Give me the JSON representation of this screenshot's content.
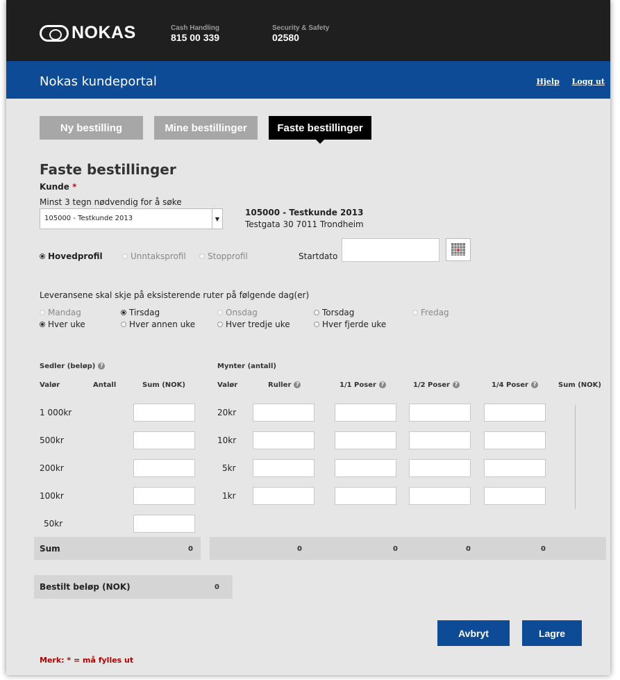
{
  "header": {
    "logo_text": "NOKAS",
    "contacts": [
      {
        "label": "Cash Handling",
        "number": "815 00 339"
      },
      {
        "label": "Security & Safety",
        "number": "02580"
      }
    ],
    "portal_title": "Nokas kundeportal",
    "links": {
      "help": "Hjelp",
      "logout": "Logg ut"
    }
  },
  "tabs": [
    {
      "label": "Ny bestilling",
      "active": false
    },
    {
      "label": "Mine bestillinger",
      "active": false
    },
    {
      "label": "Faste bestillinger",
      "active": true
    }
  ],
  "form": {
    "title": "Faste bestillinger",
    "customer_label": "Kunde",
    "required_mark": "*",
    "search_hint": "Minst 3 tegn nødvendig for å søke",
    "customer_value": "105000 - Testkunde 2013",
    "customer_name": "105000 - Testkunde 2013",
    "customer_address": "Testgata 30 7011 Trondheim",
    "profiles": [
      {
        "label": "Hovedprofil",
        "selected": true,
        "enabled": true
      },
      {
        "label": "Unntaksprofil",
        "selected": false,
        "enabled": false
      },
      {
        "label": "Stopprofil",
        "selected": false,
        "enabled": false
      }
    ],
    "start_date_label": "Startdato",
    "start_date_value": "",
    "delivery_text": "Leveransene skal skje på eksisterende ruter på følgende dag(er)",
    "days": [
      {
        "label": "Mandag",
        "selected": false,
        "enabled": false
      },
      {
        "label": "Tirsdag",
        "selected": true,
        "enabled": true
      },
      {
        "label": "Onsdag",
        "selected": false,
        "enabled": false
      },
      {
        "label": "Torsdag",
        "selected": false,
        "enabled": true
      },
      {
        "label": "Fredag",
        "selected": false,
        "enabled": false
      }
    ],
    "frequencies": [
      {
        "label": "Hver uke",
        "selected": true
      },
      {
        "label": "Hver annen uke",
        "selected": false
      },
      {
        "label": "Hver tredje uke",
        "selected": false
      },
      {
        "label": "Hver fjerde uke",
        "selected": false
      }
    ]
  },
  "notes_section": {
    "title": "Sedler (beløp)",
    "col_valor": "Valør",
    "col_antall": "Antall",
    "col_sum": "Sum (NOK)",
    "rows": [
      "1 000kr",
      "500kr",
      "200kr",
      "100kr",
      "50kr"
    ]
  },
  "coins_section": {
    "title": "Mynter (antall)",
    "col_valor": "Valør",
    "col_ruller": "Ruller",
    "col_full": "1/1 Poser",
    "col_half": "1/2 Poser",
    "col_quarter": "1/4 Poser",
    "col_sum": "Sum (NOK)",
    "rows": [
      "20kr",
      "10kr",
      "5kr",
      "1kr"
    ]
  },
  "sums": {
    "label": "Sum",
    "notes_total": "0",
    "ruller": "0",
    "full": "0",
    "half": "0",
    "quarter": "0"
  },
  "ordered": {
    "label": "Bestilt beløp (NOK)",
    "value": "0"
  },
  "buttons": {
    "cancel": "Avbryt",
    "save": "Lagre"
  },
  "note": "Merk: * = må fylles ut"
}
